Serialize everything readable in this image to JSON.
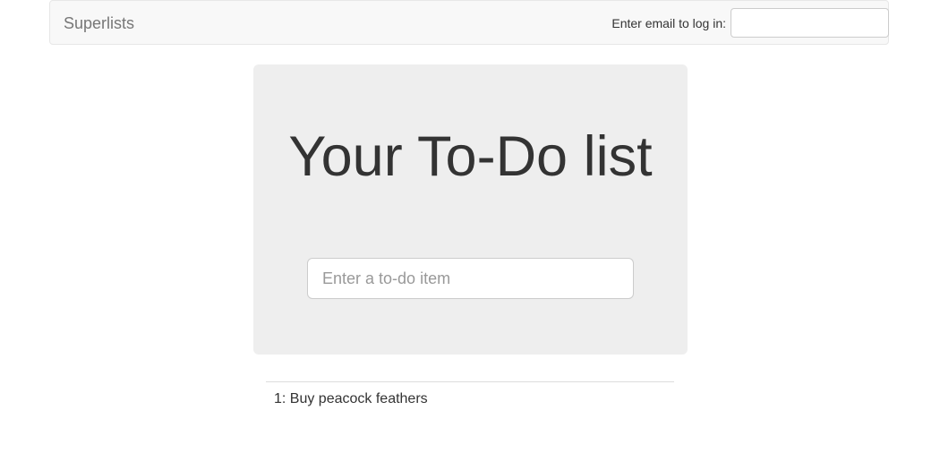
{
  "navbar": {
    "brand": "Superlists",
    "login_label": "Enter email to log in:",
    "login_value": ""
  },
  "jumbotron": {
    "title": "Your To-Do list",
    "input_placeholder": "Enter a to-do item"
  },
  "list": {
    "items": [
      "1: Buy peacock feathers"
    ]
  }
}
